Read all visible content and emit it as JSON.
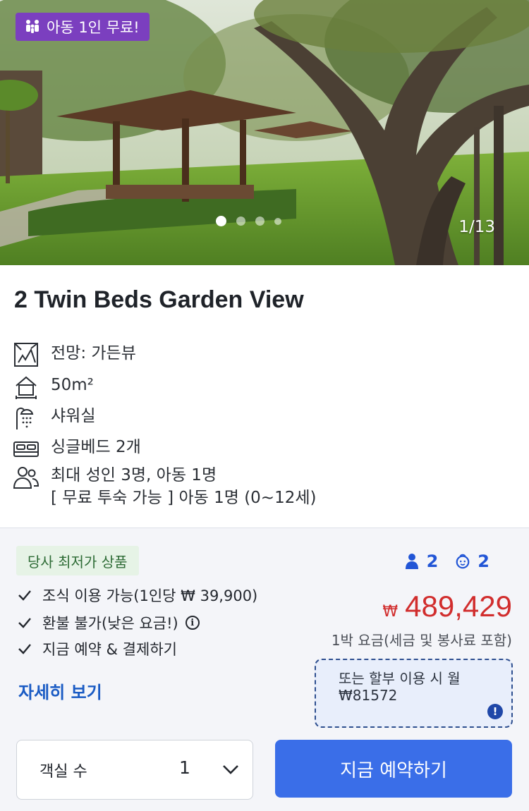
{
  "hero": {
    "promo_badge": "아동 1인 무료!",
    "counter": "1/13",
    "slide_total": 13,
    "slide_current": 1
  },
  "room": {
    "title": "2 Twin Beds Garden View",
    "features": [
      {
        "icon": "window-view-icon",
        "text": "전망: 가든뷰"
      },
      {
        "icon": "house-area-icon",
        "text": "50m²"
      },
      {
        "icon": "shower-icon",
        "text": "샤워실"
      },
      {
        "icon": "bed-icon",
        "text": "싱글베드 2개"
      },
      {
        "icon": "people-icon",
        "text": "최대 성인 3명, 아동 1명",
        "text2": "[ 무료 투숙 가능 ] 아동 1명 (0~12세)"
      }
    ]
  },
  "offer": {
    "best_badge": "당사 최저가 상품",
    "checks": [
      "조식 이용 가능(1인당 ₩ 39,900)",
      "환불 불가(낮은 요금!)",
      "지금 예약 & 결제하기"
    ],
    "detail_link": "자세히 보기",
    "adults": "2",
    "children": "2",
    "currency": "₩",
    "price": "489,429",
    "price_note": "1박 요금(세금 및 봉사료 포함)",
    "installment_line1": "또는 할부 이용 시 월",
    "installment_line2": "₩81572",
    "alert_glyph": "!",
    "room_count_label": "객실 수",
    "room_count_value": "1",
    "book_button": "지금 예약하기"
  },
  "colors": {
    "accent_blue": "#3a6ee8",
    "price_red": "#d12d2d",
    "promo_purple": "#7b3fbf",
    "badge_green_bg": "#e6f3e6"
  }
}
